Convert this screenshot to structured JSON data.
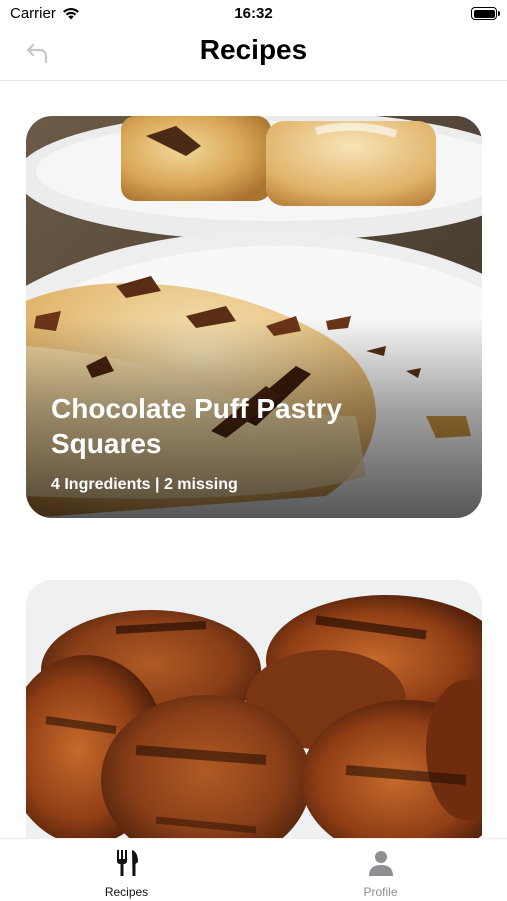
{
  "status_bar": {
    "carrier": "Carrier",
    "time": "16:32"
  },
  "nav": {
    "title": "Recipes",
    "back_icon": "back-arrow-icon"
  },
  "recipes": [
    {
      "title": "Chocolate Puff Pastry\nSquares",
      "subtitle": "4 Ingredients | 2 missing"
    },
    {
      "title": "",
      "subtitle": ""
    }
  ],
  "tabs": [
    {
      "label": "Recipes",
      "icon": "fork-knife-icon",
      "selected": true
    },
    {
      "label": "Profile",
      "icon": "person-icon",
      "selected": false
    }
  ],
  "colors": {
    "tab_active": "#111111",
    "tab_inactive": "#8e8e93"
  }
}
